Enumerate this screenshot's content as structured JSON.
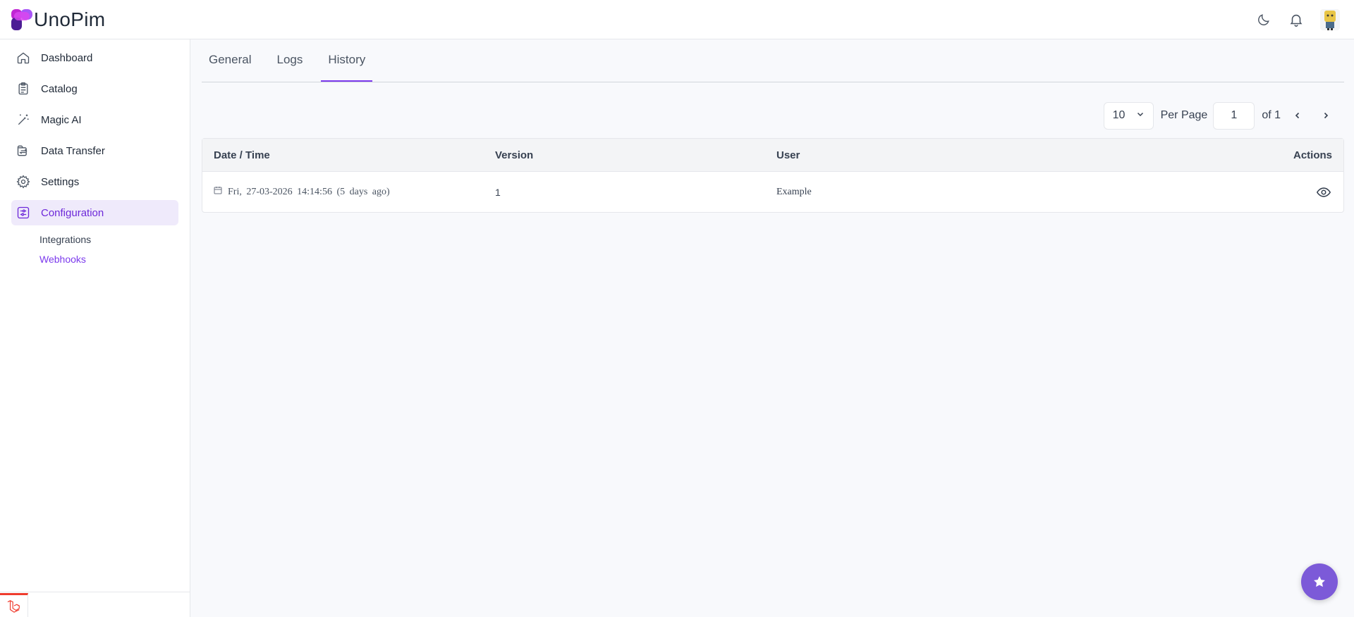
{
  "app": {
    "logo_text": "UnoPim",
    "colors": {
      "accent": "#7c3aed",
      "active_bg": "#efeafb",
      "fab": "#7c5ad8",
      "laravel_red": "#ef3b2d"
    }
  },
  "header": {
    "icons": [
      "moon-icon",
      "bell-icon",
      "user-avatar"
    ]
  },
  "sidebar": {
    "items": [
      {
        "label": "Dashboard",
        "icon": "home-icon"
      },
      {
        "label": "Catalog",
        "icon": "clipboard-icon"
      },
      {
        "label": "Magic AI",
        "icon": "magic-wand-icon"
      },
      {
        "label": "Data Transfer",
        "icon": "transfer-icon"
      },
      {
        "label": "Settings",
        "icon": "gear-icon"
      },
      {
        "label": "Configuration",
        "icon": "sliders-icon",
        "active": true
      }
    ],
    "sub_items": [
      {
        "label": "Integrations"
      },
      {
        "label": "Webhooks",
        "active": true
      }
    ]
  },
  "tabs": [
    {
      "label": "General"
    },
    {
      "label": "Logs"
    },
    {
      "label": "History",
      "active": true
    }
  ],
  "pager": {
    "per_page_value": "10",
    "per_page_label": "Per Page",
    "page_value": "1",
    "of_label": "of 1"
  },
  "table": {
    "columns": [
      "Date / Time",
      "Version",
      "User",
      "Actions"
    ],
    "rows": [
      {
        "datetime": "Fri, 27-03-2026 14:14:56 (5 days ago)",
        "version": "1",
        "user": "Example",
        "action_icon": "eye-icon"
      }
    ]
  },
  "fab": {
    "icon": "star-icon"
  }
}
